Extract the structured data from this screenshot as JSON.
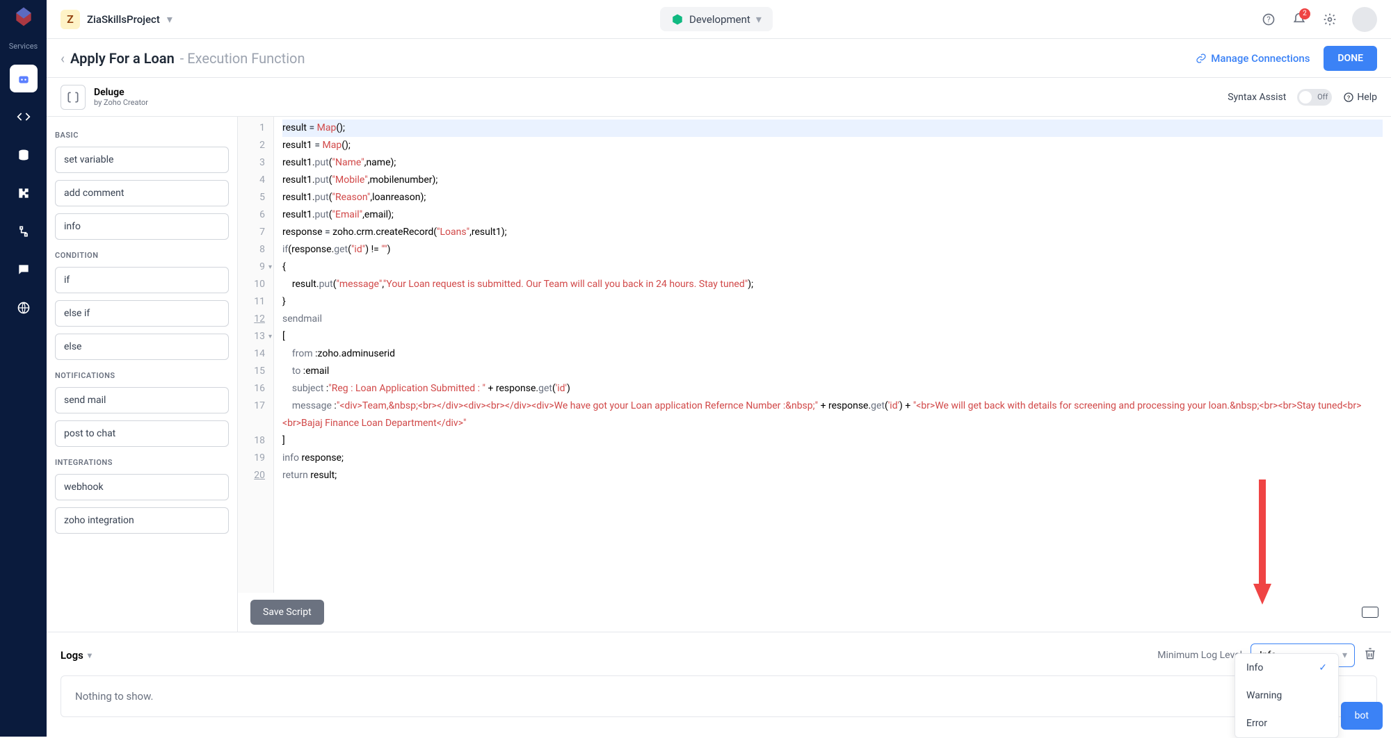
{
  "header": {
    "project_initial": "Z",
    "project_name": "ZiaSkillsProject",
    "environment": "Development",
    "notification_count": "2",
    "services_label": "Services"
  },
  "subheader": {
    "title": "Apply For a Loan",
    "subtitle": "- Execution Function",
    "manage_connections": "Manage Connections",
    "done": "DONE"
  },
  "langbar": {
    "name": "Deluge",
    "by": "by Zoho Creator",
    "syntax_assist": "Syntax Assist",
    "toggle_state": "Off",
    "help": "Help"
  },
  "snippets": {
    "cat_basic": "BASIC",
    "basic": [
      "set variable",
      "add comment",
      "info"
    ],
    "cat_condition": "CONDITION",
    "condition": [
      "if",
      "else if",
      "else"
    ],
    "cat_notifications": "NOTIFICATIONS",
    "notifications": [
      "send mail",
      "post to chat"
    ],
    "cat_integrations": "INTEGRATIONS",
    "integrations": [
      "webhook",
      "zoho integration"
    ]
  },
  "editor": {
    "save_button": "Save Script",
    "line_numbers": [
      "1",
      "2",
      "3",
      "4",
      "5",
      "6",
      "7",
      "8",
      "9",
      "10",
      "11",
      "12",
      "13",
      "14",
      "15",
      "16",
      "17",
      "18",
      "19",
      "20"
    ]
  },
  "logs": {
    "title": "Logs",
    "min_label": "Minimum Log Level",
    "selected": "Info",
    "empty": "Nothing to show.",
    "options": [
      "Info",
      "Warning",
      "Error"
    ]
  },
  "bot_button": "bot",
  "code": {
    "l1": "result = Map();",
    "l2": "result1 = Map();",
    "l3": "result1.put(\"Name\",name);",
    "l4": "result1.put(\"Mobile\",mobilenumber);",
    "l5": "result1.put(\"Reason\",loanreason);",
    "l6": "result1.put(\"Email\",email);",
    "l7": "response = zoho.crm.createRecord(\"Loans\",result1);",
    "l8": "if(response.get(\"id\") != \"\")",
    "l9": "{",
    "l10": "    result.put(\"message\",\"Your Loan request is submitted. Our Team will call you back in 24 hours. Stay tuned\");",
    "l11": "}",
    "l12": "sendmail",
    "l13": "[",
    "l14": "    from :zoho.adminuserid",
    "l15": "    to :email",
    "l16": "    subject :\"Reg : Loan Application Submitted : \" + response.get('id')",
    "l17": "    message :\"<div>Team,&nbsp;<br></div><div><br></div><div>We have got your Loan application Refernce Number :&nbsp;\" + response.get('id') + \"<br>We will get back with details for screening and processing your loan.&nbsp;<br><br>Stay tuned<br><br>Bajaj Finance Loan Department</div>\"",
    "l18": "]",
    "l19": "info response;",
    "l20": "return result;"
  }
}
